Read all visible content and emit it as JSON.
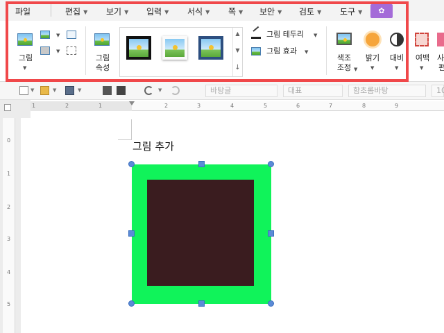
{
  "menu": {
    "file": "파일",
    "items": [
      "편집",
      "보기",
      "입력",
      "서식",
      "쪽",
      "보안",
      "검토",
      "도구"
    ]
  },
  "ribbon": {
    "picture_label": "그림",
    "picture_props_line1": "그림",
    "picture_props_line2": "속성",
    "border_label": "그림 테두리",
    "effect_label": "그림 효과",
    "color_line1": "색조",
    "color_line2": "조정",
    "brightness_label": "밝기",
    "contrast_label": "대비",
    "margin_label": "여백",
    "clipped_label": "사",
    "clipped_label2": "편"
  },
  "toolbar": {
    "style_field": "바탕글",
    "rep_field": "대표",
    "font_field": "함초롬바탕",
    "size_field": "10"
  },
  "ruler": {
    "h_numbers": [
      "1",
      "2",
      "1",
      "2",
      "3",
      "4",
      "5",
      "6",
      "7",
      "8",
      "9"
    ],
    "v_numbers": [
      "0",
      "1",
      "2",
      "3",
      "4",
      "5",
      "6"
    ]
  },
  "document": {
    "text": "그림 추가"
  },
  "colors": {
    "highlight_box": "#f0484a",
    "shape_outer": "#10f35a",
    "shape_inner": "#3a1c1f",
    "handles": "#5b8bd6",
    "menu_accent": "#a46bd8"
  },
  "icons": [
    "picture-icon",
    "insert-picture-icon",
    "crop-icon",
    "picture-properties-icon",
    "border-pen-icon",
    "effect-icon",
    "color-adjust-icon",
    "brightness-sun-icon",
    "contrast-icon",
    "margin-icon"
  ]
}
